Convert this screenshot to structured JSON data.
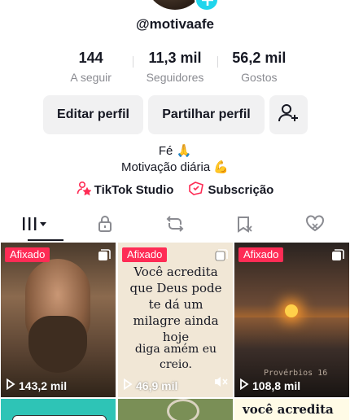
{
  "profile": {
    "username": "@motivaafe",
    "stats": [
      {
        "value": "144",
        "label": "A seguir"
      },
      {
        "value": "11,3 mil",
        "label": "Seguidores"
      },
      {
        "value": "56,2 mil",
        "label": "Gostos"
      }
    ],
    "buttons": {
      "edit": "Editar perfil",
      "share": "Partilhar perfil",
      "add_friend_icon": "add-user-icon"
    },
    "bio": [
      "Fé 🙏",
      "Motivação diária 💪"
    ],
    "links": [
      {
        "label": "TikTok Studio",
        "icon": "studio-icon"
      },
      {
        "label": "Subscrição",
        "icon": "subscription-icon"
      }
    ]
  },
  "tabs": [
    {
      "icon": "grid-icon",
      "active": true
    },
    {
      "icon": "lock-icon",
      "active": false
    },
    {
      "icon": "repost-icon",
      "active": false
    },
    {
      "icon": "favorites-icon",
      "active": false
    },
    {
      "icon": "liked-icon",
      "active": false
    }
  ],
  "videos": [
    {
      "pinned_label": "Afixado",
      "views": "143,2 mil"
    },
    {
      "pinned_label": "Afixado",
      "views": "46,9 mil",
      "text_1": "Você acredita que Deus pode te dá um milagre ainda hoje",
      "text_2": "diga amém eu creio."
    },
    {
      "pinned_label": "Afixado",
      "views": "108,8 mil",
      "overlay": "Provérbios 16"
    },
    {},
    {},
    {
      "text": "você acredita"
    }
  ],
  "colors": {
    "pin_badge": "#fe2c55",
    "button_bg": "#f1f1f2",
    "accent_link": "#fe2c55"
  }
}
